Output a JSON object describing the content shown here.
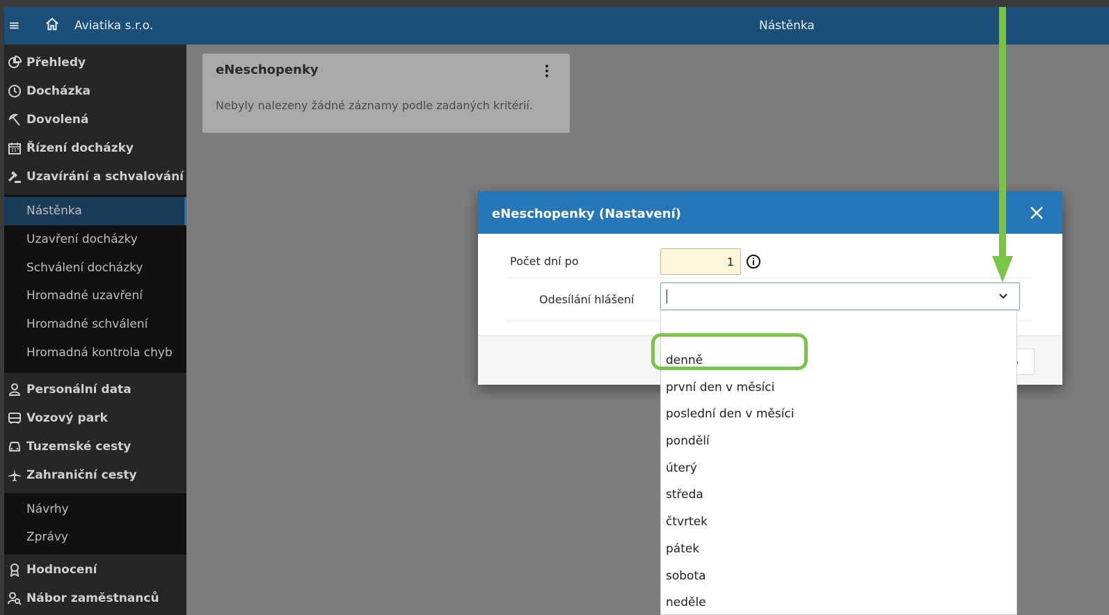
{
  "header": {
    "menu_icon": "menu-icon",
    "home_icon": "home-icon",
    "company": "Aviatika s.r.o.",
    "title": "Nástěnka"
  },
  "sidebar": {
    "items": [
      {
        "label": "Přehledy",
        "icon": "pie-chart-icon"
      },
      {
        "label": "Docházka",
        "icon": "clock-icon"
      },
      {
        "label": "Dovolená",
        "icon": "beach-umbrella-icon"
      },
      {
        "label": "Řízení docházky",
        "icon": "calendar-icon"
      },
      {
        "label": "Uzavírání a schvalování",
        "icon": "gavel-icon"
      }
    ],
    "approval_subitems": [
      {
        "label": "Nástěnka",
        "active": true
      },
      {
        "label": "Uzavření docházky"
      },
      {
        "label": "Schválení docházky"
      },
      {
        "label": "Hromadné uzavření"
      },
      {
        "label": "Hromadné schválení"
      },
      {
        "label": "Hromadná kontrola chyb"
      }
    ],
    "items2": [
      {
        "label": "Personální data",
        "icon": "person-icon"
      },
      {
        "label": "Vozový park",
        "icon": "bus-icon"
      },
      {
        "label": "Tuzemské cesty",
        "icon": "car-icon"
      },
      {
        "label": "Zahraniční cesty",
        "icon": "plane-icon"
      }
    ],
    "travel_subitems": [
      {
        "label": "Návrhy"
      },
      {
        "label": "Zprávy"
      }
    ],
    "items3": [
      {
        "label": "Hodnocení",
        "icon": "award-icon"
      },
      {
        "label": "Nábor zaměstnanců",
        "icon": "person-search-icon"
      }
    ]
  },
  "card": {
    "title": "eNeschopenky",
    "message": "Nebyly nalezeny žádné záznamy podle zadaných kritérií."
  },
  "dialog": {
    "title": "eNeschopenky (Nastavení)",
    "days_label": "Počet dní po",
    "days_value": "1",
    "send_label": "Odesílání hlášení",
    "send_value": "",
    "footer_button_fragment": "o"
  },
  "dropdown": {
    "options": [
      "",
      "denně",
      "první den v měsíci",
      "poslední den v měsíci",
      "pondělí",
      "úterý",
      "středa",
      "čtvrtek",
      "pátek",
      "sobota",
      "neděle"
    ],
    "highlighted": "denně"
  },
  "colors": {
    "topbar": "#1c4f78",
    "dialog_header": "#2577b7",
    "annotation": "#79c447",
    "sidebar": "#262626"
  }
}
